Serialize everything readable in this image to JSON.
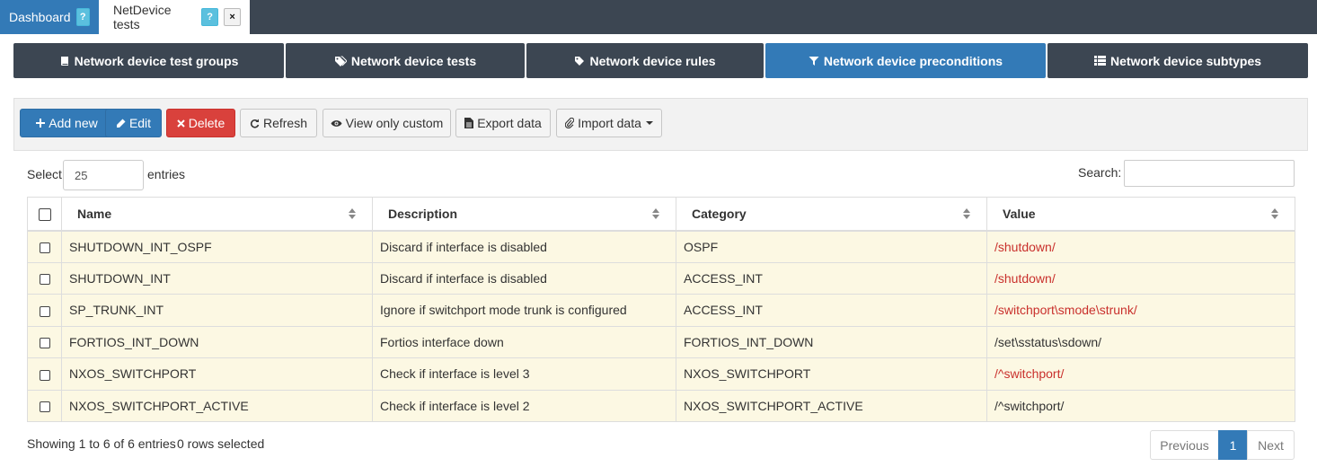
{
  "top_tabs": [
    {
      "label": "Dashboard",
      "help": "?"
    },
    {
      "label": "NetDevice tests",
      "help": "?",
      "close": "×"
    }
  ],
  "section_nav": [
    {
      "label": "Network device test groups",
      "icon": "book-icon"
    },
    {
      "label": "Network device tests",
      "icon": "tags-icon"
    },
    {
      "label": "Network device rules",
      "icon": "tag-icon"
    },
    {
      "label": "Network device preconditions",
      "icon": "filter-icon",
      "active": true
    },
    {
      "label": "Network device subtypes",
      "icon": "list-icon"
    }
  ],
  "toolbar": {
    "add_label": "Add new",
    "edit_label": "Edit",
    "delete_label": "Delete",
    "refresh_label": "Refresh",
    "view_custom_label": "View only custom",
    "export_label": "Export data",
    "import_label": "Import data"
  },
  "length": {
    "select_label": "Select",
    "value": "25",
    "entries_label": "entries"
  },
  "search": {
    "label": "Search:",
    "value": ""
  },
  "table": {
    "columns": [
      "Name",
      "Description",
      "Category",
      "Value"
    ],
    "rows": [
      {
        "name": "SHUTDOWN_INT_OSPF",
        "description": "Discard if interface is disabled",
        "category": "OSPF",
        "value": "/shutdown/",
        "value_red": true
      },
      {
        "name": "SHUTDOWN_INT",
        "description": "Discard if interface is disabled",
        "category": "ACCESS_INT",
        "value": "/shutdown/",
        "value_red": true
      },
      {
        "name": "SP_TRUNK_INT",
        "description": "Ignore if switchport mode trunk is configured",
        "category": "ACCESS_INT",
        "value": "/switchport\\smode\\strunk/",
        "value_red": true
      },
      {
        "name": "FORTIOS_INT_DOWN",
        "description": "Fortios interface down",
        "category": "FORTIOS_INT_DOWN",
        "value": "/set\\sstatus\\sdown/",
        "value_red": false
      },
      {
        "name": "NXOS_SWITCHPORT",
        "description": "Check if interface is level 3",
        "category": "NXOS_SWITCHPORT",
        "value": "/^switchport/",
        "value_red": true
      },
      {
        "name": "NXOS_SWITCHPORT_ACTIVE",
        "description": "Check if interface is level 2",
        "category": "NXOS_SWITCHPORT_ACTIVE",
        "value": "/^switchport/",
        "value_red": false
      }
    ]
  },
  "footer": {
    "info": "Showing 1 to 6 of 6 entries",
    "selected": "0 rows selected",
    "prev_label": "Previous",
    "page": "1",
    "next_label": "Next"
  },
  "colors": {
    "nav_dark": "#3c4652",
    "primary": "#337ab7",
    "danger": "#d9413c",
    "row_highlight": "#fcf8e3",
    "regex_red": "#c9302c"
  }
}
